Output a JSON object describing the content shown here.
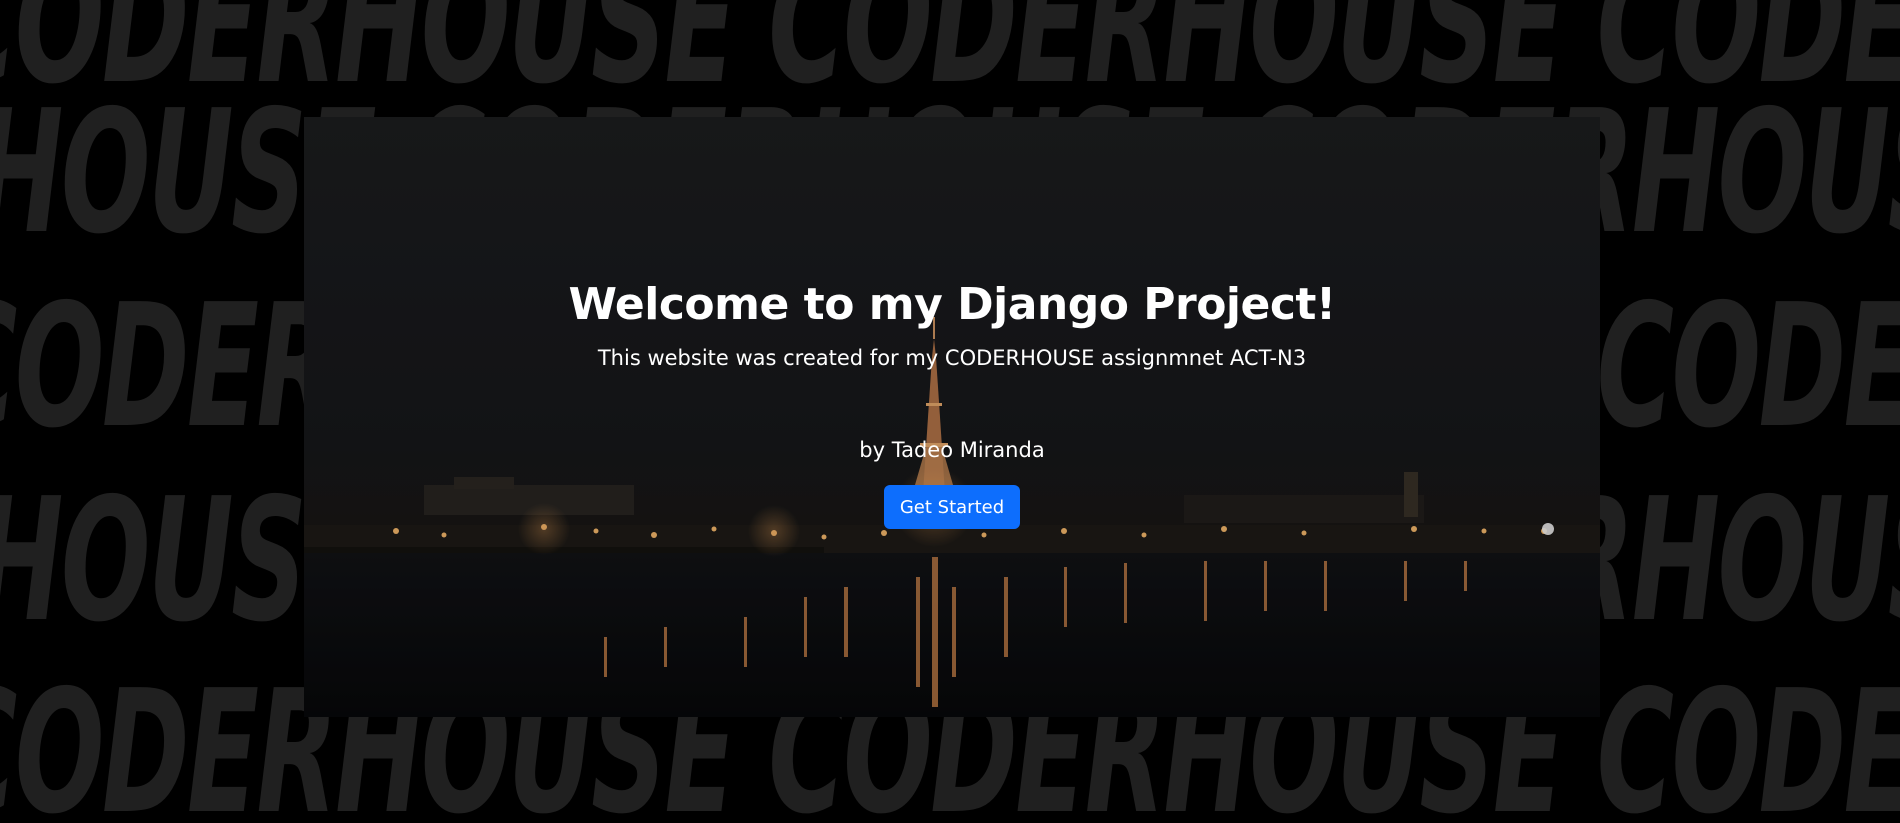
{
  "background": {
    "brand_text": "CODERHOUSE CODERHOUSE CODERHOUSE CODERHOUSE CODERHOUSE"
  },
  "hero": {
    "title": "Welcome to my Django Project!",
    "subtitle": "This website was created for my CODERHOUSE assignmnet ACT-N3",
    "author": "by Tadeo Miranda",
    "cta_label": "Get Started",
    "cta_color": "#0d6efd",
    "image_subject": "eiffel-tower-night-river"
  }
}
